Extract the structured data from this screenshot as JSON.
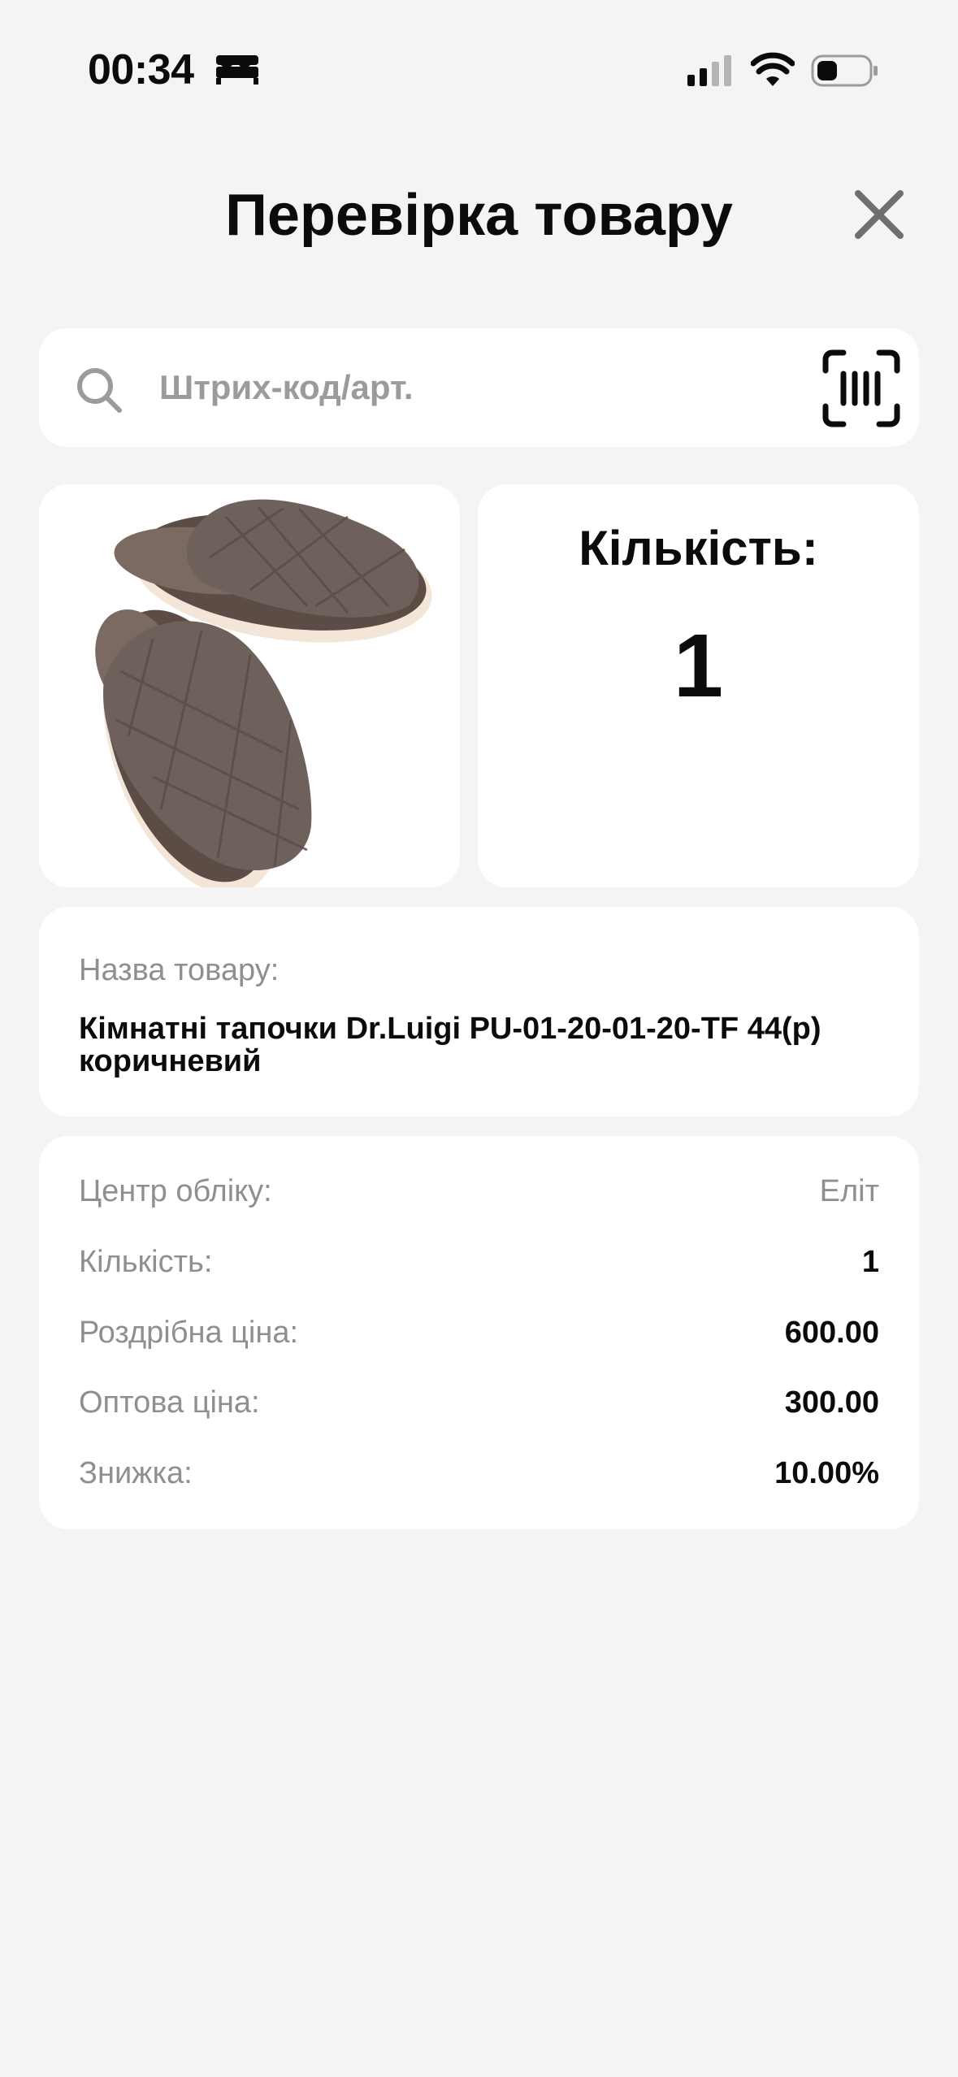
{
  "status_bar": {
    "time": "00:34",
    "sleep_icon": "bed-icon",
    "signal_icon": "cellular-signal-icon",
    "wifi_icon": "wifi-icon",
    "battery_icon": "battery-icon"
  },
  "header": {
    "title": "Перевірка товару",
    "close_icon": "close-icon"
  },
  "search": {
    "placeholder": "Штрих-код/арт.",
    "value": "",
    "search_icon": "search-icon",
    "scan_icon": "barcode-scan-icon"
  },
  "product": {
    "image_alt": "slippers-image",
    "quantity_label": "Кількість:",
    "quantity_value": "1",
    "name_label": "Назва товару:",
    "name_value": "Кімнатні тапочки Dr.Luigi PU-01-20-01-20-TF 44(р) коричневий"
  },
  "details": [
    {
      "label": "Центр обліку:",
      "value": "Еліт"
    },
    {
      "label": "Кількість:",
      "value": "1"
    },
    {
      "label": "Роздрібна ціна:",
      "value": "600.00"
    },
    {
      "label": "Оптова ціна:",
      "value": "300.00"
    },
    {
      "label": "Знижка:",
      "value": "10.00%"
    }
  ],
  "colors": {
    "background": "#f4f4f4",
    "card": "#ffffff",
    "text": "#0b0b0b",
    "muted": "#8f8f8f",
    "close": "#6f6f6f"
  }
}
